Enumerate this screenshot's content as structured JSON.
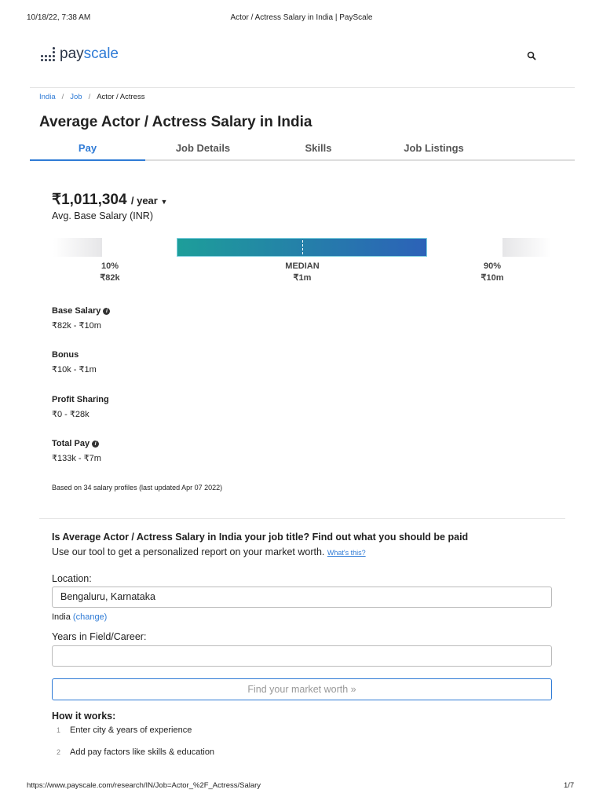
{
  "print_header": {
    "datetime": "10/18/22, 7:38 AM",
    "title": "Actor / Actress Salary in India | PayScale"
  },
  "print_footer": {
    "url": "https://www.payscale.com/research/IN/Job=Actor_%2F_Actress/Salary",
    "page": "1/7"
  },
  "logo": {
    "text_a": "pay",
    "text_b": "scale"
  },
  "breadcrumb": [
    "India",
    "Job",
    "Actor / Actress"
  ],
  "title": "Average Actor / Actress Salary in India",
  "tabs": [
    "Pay",
    "Job Details",
    "Skills",
    "Job Listings"
  ],
  "salary": {
    "value": "₹1,011,304",
    "period": "/ year",
    "label": "Avg. Base Salary (INR)"
  },
  "range": {
    "p10_label": "10%",
    "p10": "₹82k",
    "median_label": "MEDIAN",
    "median": "₹1m",
    "p90_label": "90%",
    "p90": "₹10m",
    "colors": {
      "start": "#1d9e9a",
      "end": "#2c62b8"
    }
  },
  "stats": [
    {
      "name": "Base Salary",
      "value": "₹82k - ₹10m"
    },
    {
      "name": "Bonus",
      "value": "₹10k - ₹1m"
    },
    {
      "name": "Profit Sharing",
      "value": "₹0 - ₹28k"
    },
    {
      "name": "Total Pay",
      "value": "₹133k - ₹7m"
    }
  ],
  "based_on": "Based on 34 salary profiles (last updated Apr 07 2022)",
  "tool": {
    "heading": "Is Average Actor / Actress Salary in India your job title? Find out what you should be paid",
    "sub": "Use our tool to get a personalized report on your market worth.",
    "whats_this": "What's this?",
    "location_label": "Location:",
    "location_value": "Bengaluru, Karnataka",
    "country": "India",
    "change": "(change)",
    "years_label": "Years in Field/Career:",
    "button": "Find your market worth »",
    "how": "How it works:",
    "steps": [
      "Enter city & years of experience",
      "Add pay factors like skills & education"
    ]
  }
}
